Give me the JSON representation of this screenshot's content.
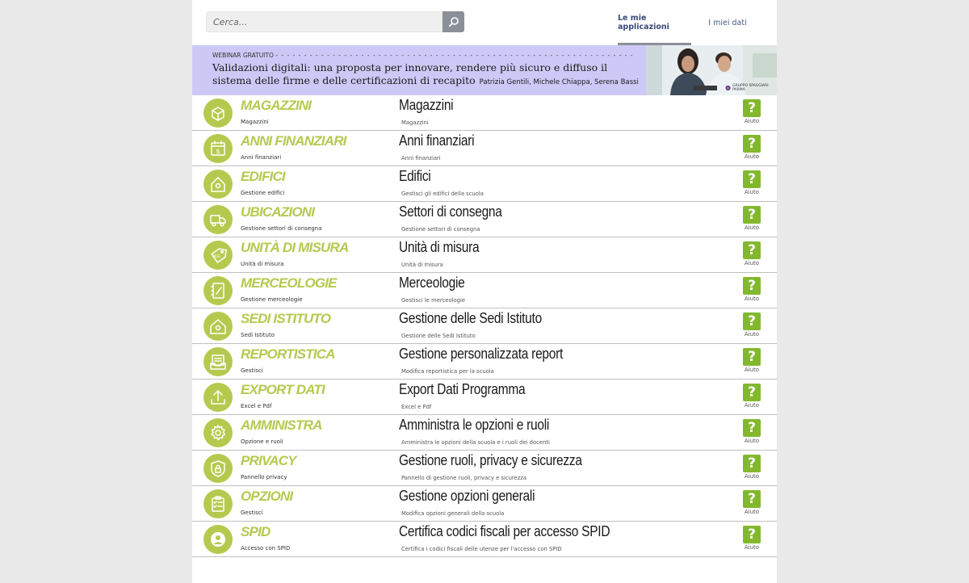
{
  "search": {
    "placeholder": "Cerca..."
  },
  "tabs": [
    {
      "label": "Le mie applicazioni",
      "active": true
    },
    {
      "label": "I miei dati",
      "active": false
    }
  ],
  "banner": {
    "kicker": "WEBINAR GRATUITO",
    "title": "Validazioni digitali: una proposta per innovare, rendere più sicuro e diffuso il sistema delle firme e delle certificazioni di recapito",
    "authors": "Patrizia Gentili, Michele Chiappa, Serena Bassi",
    "logo_text": "GRUPPO SPAGGIARI PARMA"
  },
  "colors": {
    "accent": "#b6c94f",
    "help": "#83b82e",
    "tab_text": "#4a5a86"
  },
  "apps": [
    {
      "icon": "box-icon",
      "name": "MAGAZZINI",
      "sub": "Magazzini",
      "title": "Magazzini",
      "desc": "Magazzini",
      "help": "Aiuto"
    },
    {
      "icon": "calendar-dollar-icon",
      "name": "ANNI FINANZIARI",
      "sub": "Anni finanziari",
      "title": "Anni finanziari",
      "desc": "Anni finanziari",
      "help": "Aiuto"
    },
    {
      "icon": "building-pin-icon",
      "name": "EDIFICI",
      "sub": "Gestione edifici",
      "title": "Edifici",
      "desc": "Gestisci gli edifici della scuola",
      "help": "Aiuto"
    },
    {
      "icon": "truck-icon",
      "name": "UBICAZIONI",
      "sub": "Gestione settori di consegna",
      "title": "Settori di consegna",
      "desc": "Gestione settori di consegna",
      "help": "Aiuto"
    },
    {
      "icon": "tag-kg-icon",
      "name": "UNITÀ DI MISURA",
      "sub": "Unità di misura",
      "title": "Unità di misura",
      "desc": "Unità di misura",
      "help": "Aiuto"
    },
    {
      "icon": "notebook-icon",
      "name": "MERCEOLOGIE",
      "sub": "Gestione merceologie",
      "title": "Merceologie",
      "desc": "Gestisci le merceologie",
      "help": "Aiuto"
    },
    {
      "icon": "house-pin-icon",
      "name": "SEDI ISTITUTO",
      "sub": "Sedi Istituto",
      "title": "Gestione delle Sedi Istituto",
      "desc": "Gestione delle Sedi Istituto",
      "help": "Aiuto"
    },
    {
      "icon": "inbox-report-icon",
      "name": "REPORTISTICA",
      "sub": "Gestisci",
      "title": "Gestione personalizzata report",
      "desc": "Modifica reportistica per la scuola",
      "help": "Aiuto"
    },
    {
      "icon": "upload-icon",
      "name": "EXPORT DATI",
      "sub": "Excel e Pdf",
      "title": "Export Dati Programma",
      "desc": "Excel e Pdf",
      "help": "Aiuto"
    },
    {
      "icon": "gear-icon",
      "name": "AMMINISTRA",
      "sub": "Opzione e ruoli",
      "title": "Amministra le opzioni e ruoli",
      "desc": "Amministra le opzioni della scuola e i ruoli dei docenti",
      "help": "Aiuto"
    },
    {
      "icon": "shield-lock-icon",
      "name": "PRIVACY",
      "sub": "Pannello privacy",
      "title": "Gestione ruoli, privacy e sicurezza",
      "desc": "Pannello di gestione ruoli, privacy e sicurezza",
      "help": "Aiuto"
    },
    {
      "icon": "clipboard-check-icon",
      "name": "OPZIONI",
      "sub": "Gestisci",
      "title": "Gestione opzioni generali",
      "desc": "Modifica opzioni generali della scuola",
      "help": "Aiuto"
    },
    {
      "icon": "user-circle-icon",
      "name": "SPID",
      "sub": "Accesso con SPID",
      "title": "Certifica codici fiscali per accesso SPID",
      "desc": "Certifica i codici fiscali delle utenze per l'accesso con SPID",
      "help": "Aiuto"
    }
  ]
}
